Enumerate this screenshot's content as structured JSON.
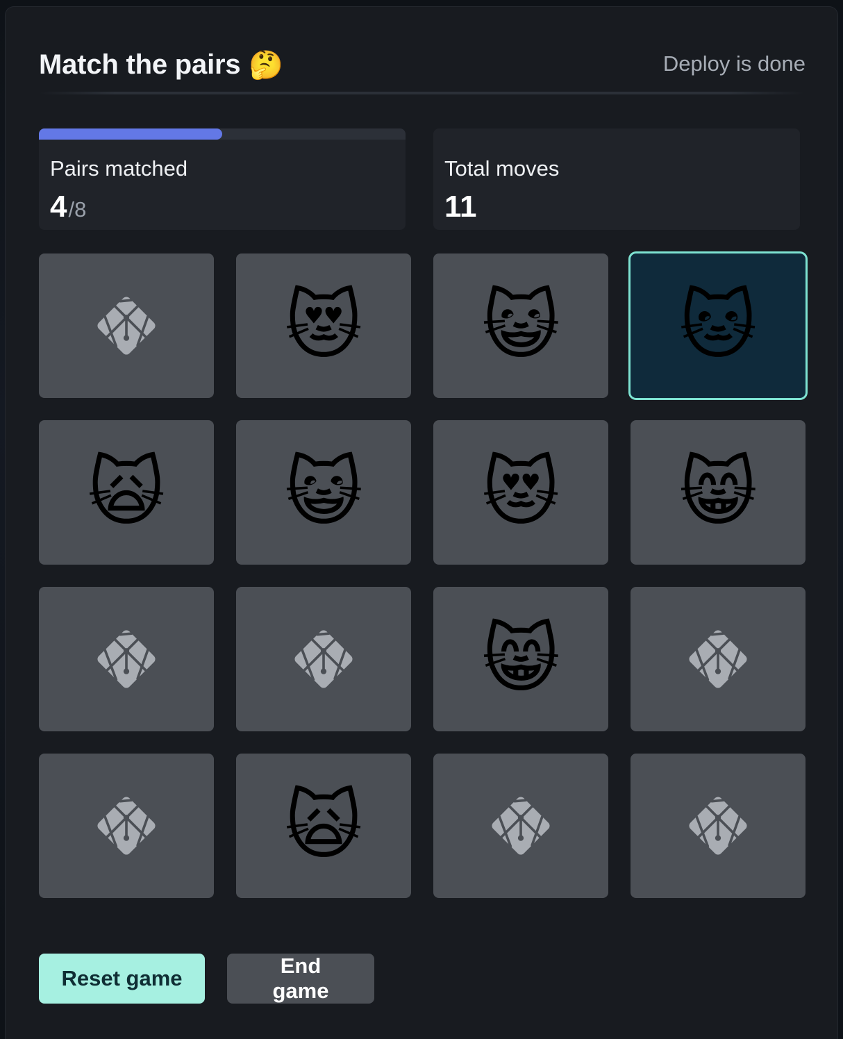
{
  "header": {
    "title": "Match the pairs",
    "title_emoji": "🤔",
    "status": "Deploy is done"
  },
  "stats": {
    "pairs_label": "Pairs matched",
    "pairs_matched": "4",
    "pairs_total": "/8",
    "progress_fraction": 0.5,
    "moves_label": "Total moves",
    "moves_value": "11"
  },
  "cards": [
    {
      "state": "hidden",
      "icon": "netlify-logo-icon"
    },
    {
      "state": "revealed",
      "emoji": "😻",
      "icon": "heart-eyes-cat-icon"
    },
    {
      "state": "revealed",
      "emoji": "😺",
      "icon": "grinning-cat-icon"
    },
    {
      "state": "selected",
      "emoji": "🐱",
      "icon": "cat-face-icon"
    },
    {
      "state": "revealed",
      "emoji": "🙀",
      "icon": "weary-cat-icon"
    },
    {
      "state": "revealed",
      "emoji": "😺",
      "icon": "grinning-cat-icon"
    },
    {
      "state": "revealed",
      "emoji": "😻",
      "icon": "heart-eyes-cat-icon"
    },
    {
      "state": "revealed",
      "emoji": "😸",
      "icon": "grinning-cat-smiling-eyes-icon"
    },
    {
      "state": "hidden",
      "icon": "netlify-logo-icon"
    },
    {
      "state": "hidden",
      "icon": "netlify-logo-icon"
    },
    {
      "state": "revealed",
      "emoji": "😸",
      "icon": "grinning-cat-smiling-eyes-icon"
    },
    {
      "state": "hidden",
      "icon": "netlify-logo-icon"
    },
    {
      "state": "hidden",
      "icon": "netlify-logo-icon"
    },
    {
      "state": "revealed",
      "emoji": "🙀",
      "icon": "weary-cat-icon"
    },
    {
      "state": "hidden",
      "icon": "netlify-logo-icon"
    },
    {
      "state": "hidden",
      "icon": "netlify-logo-icon"
    }
  ],
  "buttons": {
    "reset_label": "Reset game",
    "end_label": "End game"
  },
  "colors": {
    "accent_progress": "#6378e6",
    "selected_border": "#7ee3d2",
    "reset_button": "#a6f0e1"
  }
}
